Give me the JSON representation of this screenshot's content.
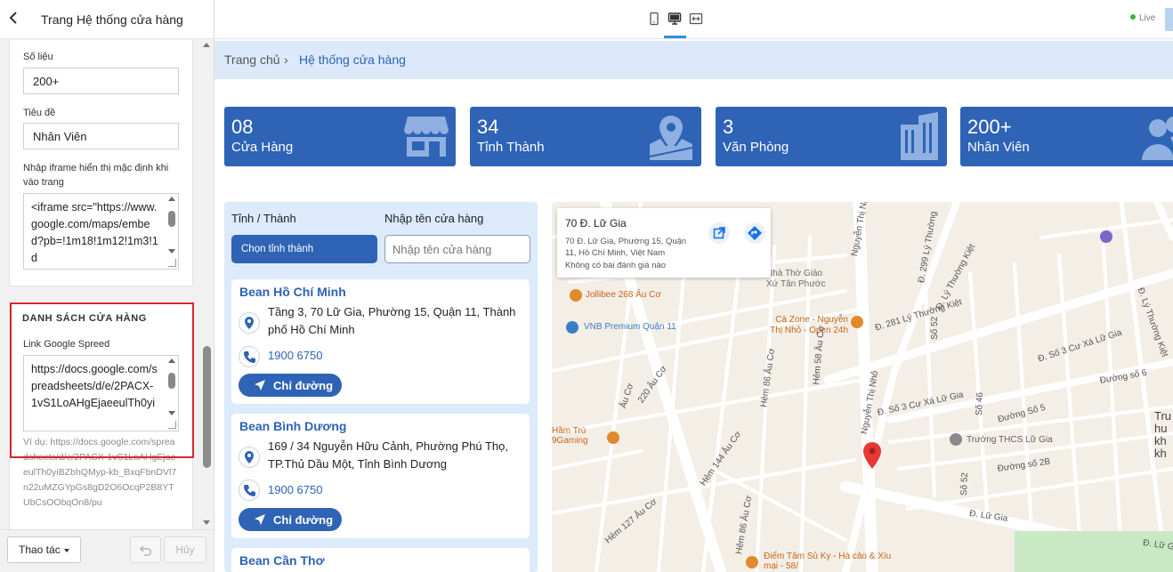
{
  "panel": {
    "title": "Trang Hệ thống cửa hàng",
    "fields": {
      "so_lieu_label": "Số liệu",
      "so_lieu_value": "200+",
      "tieu_de_label": "Tiêu đề",
      "tieu_de_value": "Nhân Viên",
      "iframe_label": "Nhập iframe hiển thị mặc định khi vào trang",
      "iframe_value": "<iframe src=\"https://www.google.com/maps/embed?pb=!1m18!1m12!1m3!1d"
    },
    "section": {
      "title": "DANH SÁCH CỬA HÀNG",
      "link_label": "Link Google Spreed",
      "link_value": "https://docs.google.com/spreadsheets/d/e/2PACX-1vS1LoAHgEjaeeulTh0yi",
      "example": "Ví dụ: https://docs.google.com/spreadsheets/d/e/2PACX-1vS1LoAHgEjaeeulTh0yiBZbhQMyp-kb_BxqFbnDVl7n22uMZGYpGs8gD2O6OcqP2B8YTUbCsOObqOn8/pu"
    },
    "footer": {
      "action_label": "Thao tác",
      "cancel_label": "Hủy"
    }
  },
  "topbar": {
    "live_label": "Live",
    "devices": [
      "mobile-icon",
      "desktop-icon",
      "fullwidth-icon"
    ],
    "active_device": "desktop-icon"
  },
  "breadcrumb": {
    "home": "Trang chủ",
    "separator": "›",
    "current": "Hệ thống cửa hàng"
  },
  "stats": [
    {
      "number": "08",
      "caption": "Cửa Hàng",
      "icon": "store-icon"
    },
    {
      "number": "34",
      "caption": "Tỉnh Thành",
      "icon": "map-pin-icon"
    },
    {
      "number": "3",
      "caption": "Văn Phòng",
      "icon": "building-icon"
    },
    {
      "number": "200+",
      "caption": "Nhân Viên",
      "icon": "users-icon"
    }
  ],
  "filters": {
    "province_label": "Tỉnh / Thành",
    "province_button": "Chọn tỉnh thành",
    "name_label": "Nhập tên cửa hàng",
    "name_placeholder": "Nhập tên cửa hàng"
  },
  "stores": [
    {
      "name": "Bean Hồ Chí Minh",
      "address": "Tầng 3, 70 Lữ Gia, Phường 15, Quận 11, Thành phố Hồ Chí Minh",
      "phone": "1900 6750",
      "directions": "Chỉ đường"
    },
    {
      "name": "Bean Bình Dương",
      "address": "169 / 34 Nguyễn Hữu Cảnh, Phường Phú Thọ, TP.Thủ Dầu Một, Tỉnh Bình Dương",
      "phone": "1900 6750",
      "directions": "Chỉ đường"
    },
    {
      "name": "Bean Cần Thơ"
    }
  ],
  "map": {
    "card_title": "70 Đ. Lữ Gia",
    "card_address": "70 Đ. Lữ Gia, Phường 15, Quận 11, Hồ Chí Minh, Việt Nam",
    "card_reviews": "Không có bài đánh giá nào",
    "labels": {
      "nha_tho": "Nhà Thờ Giáo Xứ Tân Phước",
      "nguyen_thi_nho": "Nguyễn Thị Nhỏ",
      "ly_thuong_kiet_1": "Đ. Lý Thường Kiệt",
      "ly_thuong_kiet_2": "Đ. 281 Lý Thường Kiệt",
      "ly_thuong_kiet_3": "Đ. Lý Thường Kiệt",
      "d299": "Đ. 299 Lý Thường",
      "jollibee": "Jollibee 268 Âu Cơ",
      "vnb": "VNB Premium Quận 11",
      "ca_zone": "Cà Zone - Nguyễn Thị Nhỏ - Open 24h",
      "au_co_1": "Âu Cơ",
      "au_co_2": "220 Âu Cơ",
      "hem86": "Hẻm 86 Âu Cơ",
      "hem58": "Hẻm 58 Âu Cơ",
      "hem144": "Hẻm 144 Âu Cơ",
      "hem127": "Hẻm 127 Âu Cơ",
      "hem86b": "Hẻm 86 Âu Cơ",
      "ham_tru": "Hầm Trú 9Gaming",
      "so3_cu_xa": "Đ. Số 3 Cư Xá Lữ Gia",
      "so3_cu_xa_2": "Đ. Số 3 Cư Xá Lữ Gia",
      "so52": "Số 52",
      "so52b": "Số 52",
      "so46": "Số 46",
      "so5": "Đường Số 5",
      "so6": "Đường số 6",
      "so2b": "Đường số 2B",
      "thcs": "Trường THCS Lữ Gia",
      "lu_gia": "Đ. Lữ Gia",
      "lu_gia_2": "Đ. Lữ Gia",
      "diem_tam": "Điểm Tâm Sủ Ky - Há cảo & Xíu mại - 58/",
      "tru": "Tru",
      "hu": "hu",
      "kh": "kh",
      "kh2": "kh"
    }
  },
  "colors": {
    "primary": "#2e63b6",
    "breadcrumb_bg": "#dbe9fb",
    "highlight_border": "#d7262f",
    "map_marker": "#e53935"
  }
}
